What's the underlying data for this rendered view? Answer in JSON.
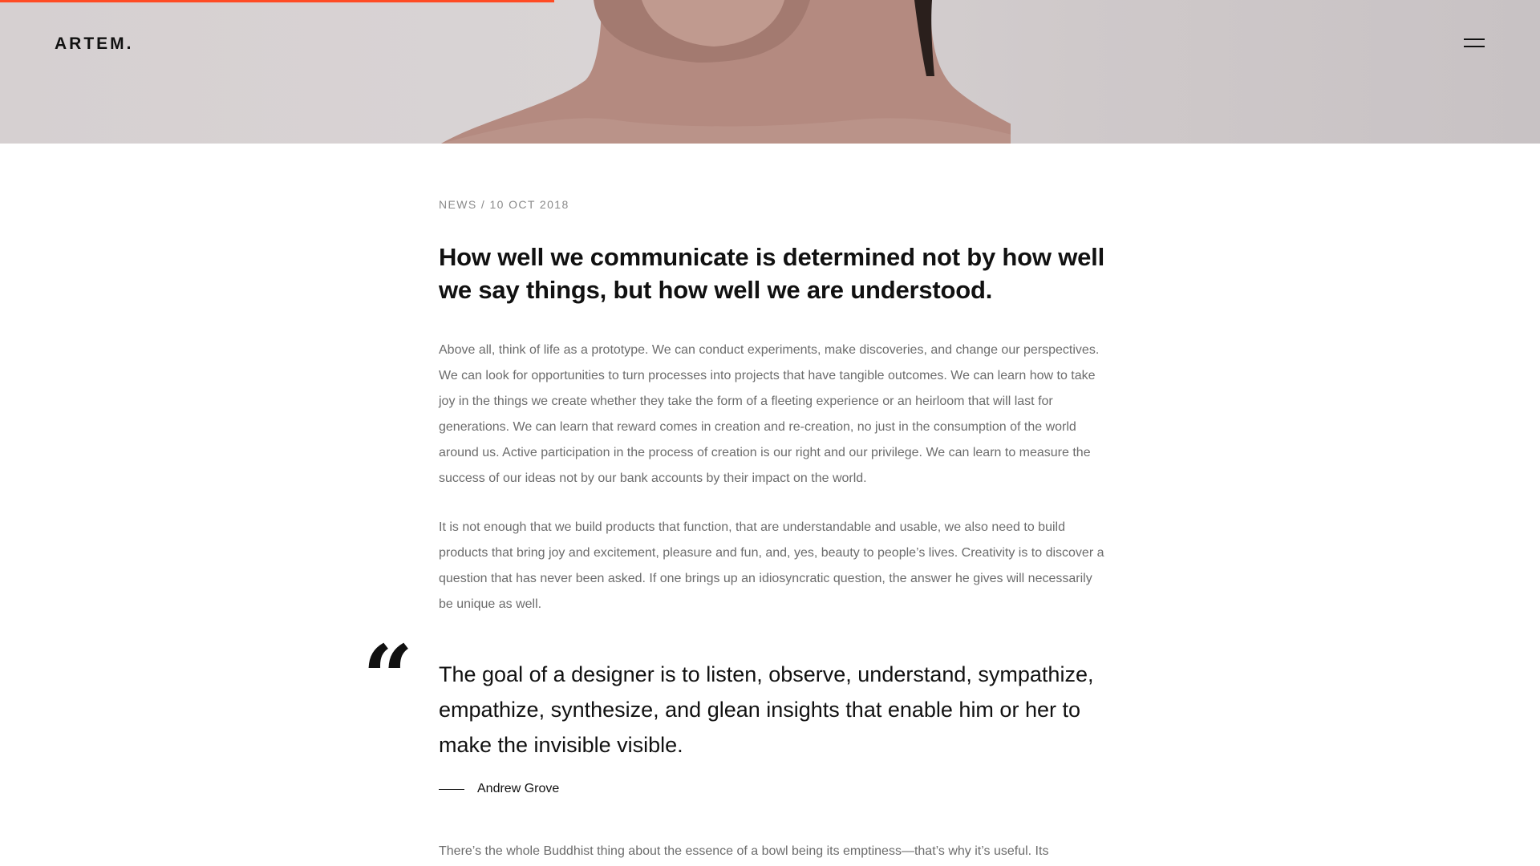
{
  "header": {
    "logo_text": "ARTEM.",
    "menu_icon": "hamburger-menu-icon",
    "progress_fraction": 0.36,
    "accent_color": "#ff4b24"
  },
  "article": {
    "meta": "NEWS / 10 OCT 2018",
    "title": "How well we communicate is determined not by how well we say things, but how well we are understood.",
    "paragraphs": [
      "Above all, think of life as a prototype. We can conduct experiments, make discoveries, and change our perspectives. We can look for opportunities to turn processes into projects that have tangible outcomes. We can learn how to take joy in the things we create whether they take the form of a fleeting experience or an heirloom that will last for generations. We can learn that reward comes in creation and re-creation, no just in the consumption of the world around us. Active participation in the process of creation is our right and our privilege. We can learn to measure the success of our ideas not by our bank accounts by their impact on the world.",
      "It is not enough that we build products that function, that are understandable and usable, we also need to build products that bring joy and excitement, pleasure and fun, and, yes, beauty to people’s lives. Creativity is to discover a question that has never been asked. If one brings up an idiosyncratic question, the answer he gives will necessarily be unique as well.",
      "There’s the whole Buddhist thing about the essence of a bowl being its emptiness—that’s why it’s useful. Its"
    ],
    "quote": {
      "mark": "“",
      "text": "The goal of a designer is to listen, observe, understand, sympathize, empathize, synthesize, and glean insights that enable him or her to make the invisible visible.",
      "author": "Andrew Grove"
    }
  }
}
